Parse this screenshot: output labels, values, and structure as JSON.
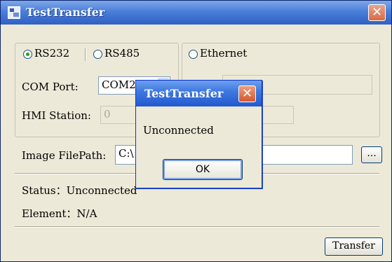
{
  "window": {
    "title": "TestTransfer",
    "close_label": "✕"
  },
  "connection": {
    "rs232_label": "RS232",
    "rs485_label": "RS485",
    "ethernet_label": "Ethernet",
    "selected": "RS232"
  },
  "serial": {
    "com_port_label": "COM Port:",
    "com_port_value": "COM2",
    "hmi_station_label": "HMI Station:",
    "hmi_station_value": "0"
  },
  "image": {
    "filepath_label": "Image FilePath:",
    "filepath_value": "C:\\",
    "browse_label": "..."
  },
  "status": {
    "status_text": "Status：Unconnected",
    "element_text": "Element：N/A"
  },
  "transfer_button_label": "Transfer",
  "dialog": {
    "title": "TestTransfer",
    "message": "Unconnected",
    "ok_label": "OK",
    "close_label": "✕"
  }
}
